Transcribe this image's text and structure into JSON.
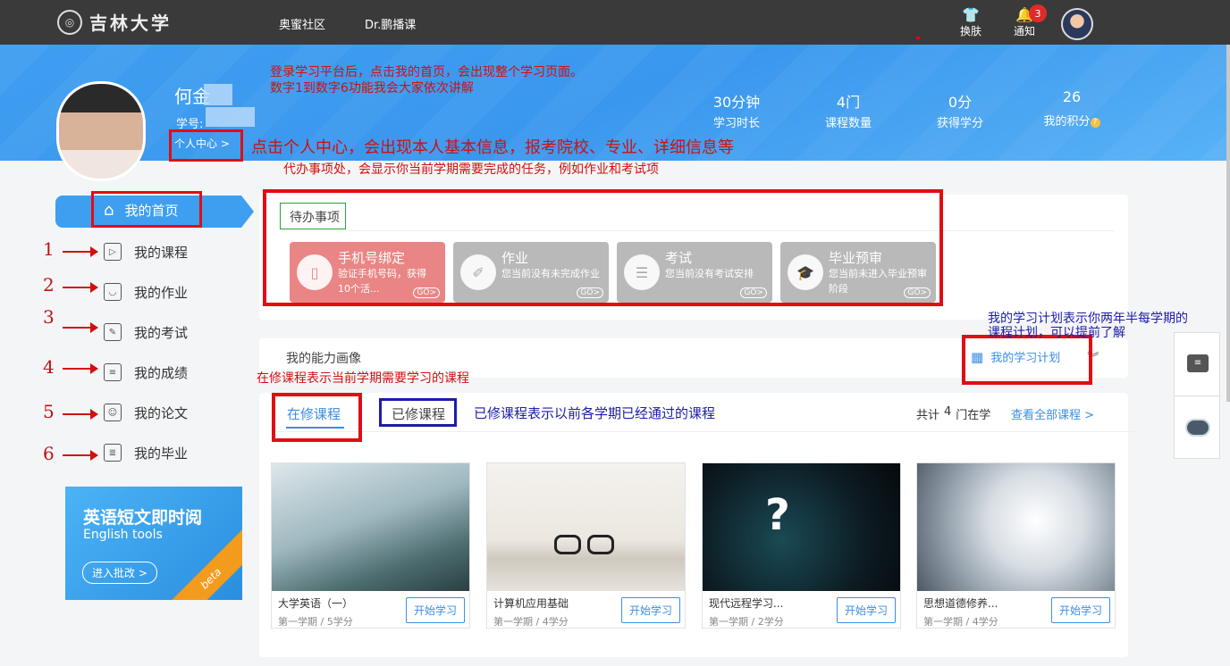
{
  "header": {
    "logo": "吉林大学",
    "nav": [
      "奥蜜社区",
      "Dr.鹏播课"
    ],
    "skin": "换肤",
    "notice": "通知",
    "notice_count": "3"
  },
  "profile": {
    "name": "何金",
    "id_label": "学号:",
    "center_link": "个人中心 >"
  },
  "stats": [
    {
      "value": "30分钟",
      "label": "学习时长"
    },
    {
      "value": "4门",
      "label": "课程数量"
    },
    {
      "value": "0分",
      "label": "获得学分"
    },
    {
      "value": "26",
      "label": "我的积分"
    }
  ],
  "annotations": {
    "a1": "登录学习平台后，点击我的首页，会出现整个学习页面。",
    "a2": "数字1到数字6功能我会大家依次讲解",
    "a3": "点击个人中心，会出现本人基本信息，报考院校、专业、详细信息等",
    "a4": "代办事项处，会显示你当前学期需要完成的任务，例如作业和考试项",
    "a5": "在修课程表示当前学期需要学习的课程",
    "a6": "已修课程表示以前各学期已经通过的课程",
    "a7": "我的学习计划表示你两年半每学期的",
    "a8": "课程计划，可以提前了解"
  },
  "sidebar": {
    "active": "我的首页",
    "items": [
      "我的课程",
      "我的作业",
      "我的考试",
      "我的成绩",
      "我的论文",
      "我的毕业"
    ],
    "numbers": [
      "1",
      "2",
      "3",
      "4",
      "5",
      "6"
    ]
  },
  "ad": {
    "title": "英语短文即时阅",
    "subtitle": "English tools",
    "button": "进入批改 >",
    "ribbon": "beta"
  },
  "todo": {
    "title": "待办事项",
    "tiles": [
      {
        "title": "手机号绑定",
        "desc": "验证手机号码，获得10个活...",
        "go": "GO>",
        "color": "#ea8585"
      },
      {
        "title": "作业",
        "desc": "您当前没有未完成作业",
        "go": "GO>",
        "color": "#b9b9b9"
      },
      {
        "title": "考试",
        "desc": "您当前没有考试安排",
        "go": "GO>",
        "color": "#b9b9b9"
      },
      {
        "title": "毕业预审",
        "desc": "您当前未进入毕业预审阶段",
        "go": "GO>",
        "color": "#b9b9b9"
      }
    ]
  },
  "ability": {
    "title": "我的能力画像",
    "plan": "我的学习计划"
  },
  "courses_section": {
    "tab_active": "在修课程",
    "tab_other": "已修课程",
    "total_prefix": "共计",
    "total_count": "4",
    "total_suffix": "门在学",
    "view_all": "查看全部课程 >"
  },
  "courses": [
    {
      "name": "大学英语（一）",
      "meta": "第一学期 / 5学分",
      "button": "开始学习"
    },
    {
      "name": "计算机应用基础",
      "meta": "第一学期 / 4学分",
      "button": "开始学习"
    },
    {
      "name": "现代远程学习...",
      "meta": "第一学期 / 2学分",
      "button": "开始学习"
    },
    {
      "name": "思想道德修养...",
      "meta": "第一学期 / 4学分",
      "button": "开始学习"
    }
  ]
}
